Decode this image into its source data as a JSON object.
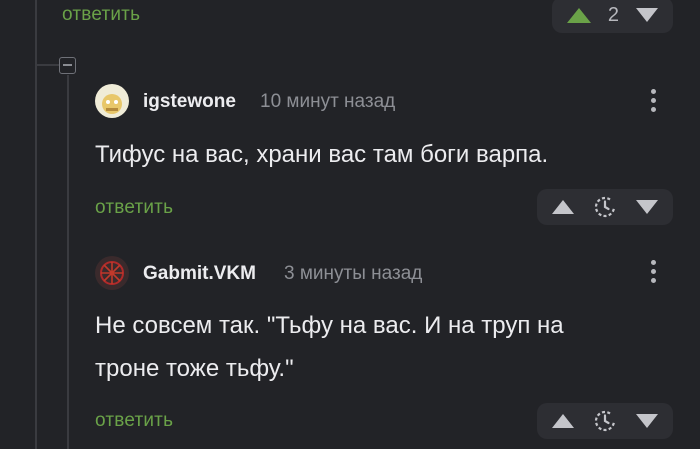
{
  "top": {
    "reply_label": "ответить",
    "score": "2"
  },
  "comments": [
    {
      "username": "igstewone",
      "time": "10 минут назад",
      "text": "Тифус на вас, храни вас там боги варпа.",
      "reply_label": "ответить"
    },
    {
      "username": "Gabmit.VKM",
      "time": "3 минуты назад",
      "text_line1": "Не совсем так. \"Тьфу на вас. И на труп на",
      "text_line2": "троне тоже тьфу.\"",
      "reply_label": "ответить"
    }
  ],
  "colors": {
    "accent": "#6aa248",
    "background": "#222327",
    "panel": "#2d2e33"
  },
  "icons": [
    "collapse-icon",
    "upvote-icon",
    "downvote-icon",
    "clock-icon",
    "more-options-icon"
  ]
}
